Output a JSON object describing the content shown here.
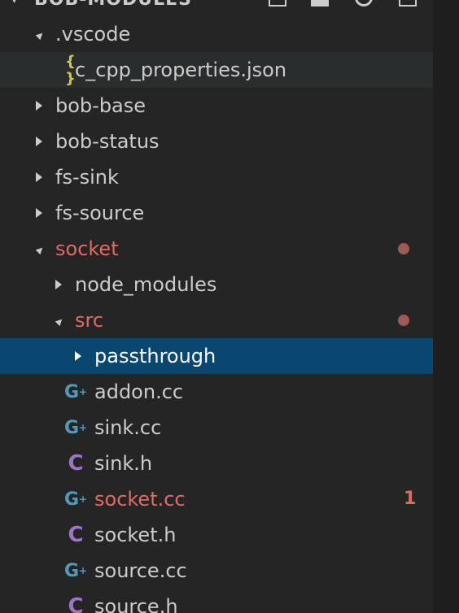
{
  "explorer": {
    "section_title": "BOB-MODULES",
    "header_actions": [
      "new-file-icon",
      "new-folder-icon",
      "refresh-icon",
      "collapse-all-icon"
    ]
  },
  "colors": {
    "background": "#252526",
    "selected_background": "#094771",
    "modified_text": "#e06c61",
    "modified_dot": "#9e5b54",
    "cpp_icon": "#519aba",
    "header_icon": "#a074c4",
    "json_icon": "#cbcb41"
  },
  "tree": [
    {
      "label": ".vscode",
      "type": "folder",
      "expanded": true,
      "depth": 0
    },
    {
      "label": "c_cpp_properties.json",
      "type": "file",
      "icon": "json-icon",
      "icon_text": "{ }",
      "depth": 1,
      "focused": true
    },
    {
      "label": "bob-base",
      "type": "folder",
      "expanded": false,
      "depth": 0
    },
    {
      "label": "bob-status",
      "type": "folder",
      "expanded": false,
      "depth": 0
    },
    {
      "label": "fs-sink",
      "type": "folder",
      "expanded": false,
      "depth": 0
    },
    {
      "label": "fs-source",
      "type": "folder",
      "expanded": false,
      "depth": 0
    },
    {
      "label": "socket",
      "type": "folder",
      "expanded": true,
      "depth": 0,
      "modified": true,
      "dot": true
    },
    {
      "label": "node_modules",
      "type": "folder",
      "expanded": false,
      "depth": 1
    },
    {
      "label": "src",
      "type": "folder",
      "expanded": true,
      "depth": 1,
      "modified": true,
      "dot": true
    },
    {
      "label": "passthrough",
      "type": "folder",
      "expanded": false,
      "depth": 2,
      "selected": true
    },
    {
      "label": "addon.cc",
      "type": "file",
      "icon": "cpp-icon",
      "depth": 2
    },
    {
      "label": "sink.cc",
      "type": "file",
      "icon": "cpp-icon",
      "depth": 2
    },
    {
      "label": "sink.h",
      "type": "file",
      "icon": "c-header-icon",
      "icon_text": "C",
      "depth": 2
    },
    {
      "label": "socket.cc",
      "type": "file",
      "icon": "cpp-icon",
      "depth": 2,
      "modified": true,
      "problems": "1"
    },
    {
      "label": "socket.h",
      "type": "file",
      "icon": "c-header-icon",
      "icon_text": "C",
      "depth": 2
    },
    {
      "label": "source.cc",
      "type": "file",
      "icon": "cpp-icon",
      "depth": 2
    },
    {
      "label": "source.h",
      "type": "file",
      "icon": "c-header-icon",
      "icon_text": "C",
      "depth": 2
    }
  ]
}
